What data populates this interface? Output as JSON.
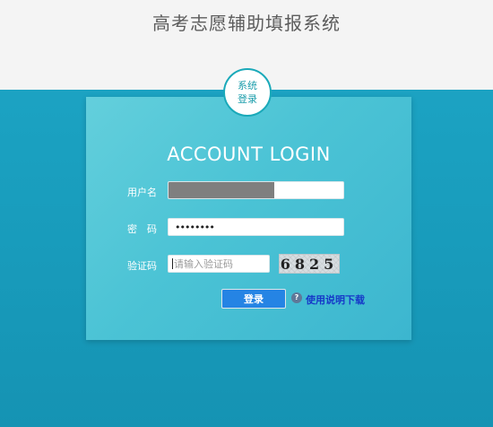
{
  "header": {
    "title": "高考志愿辅助填报系统"
  },
  "badge": {
    "line1": "系统",
    "line2": "登录"
  },
  "login": {
    "heading": "ACCOUNT LOGIN",
    "username_label": "用户名",
    "password_label": "密　码",
    "captcha_label": "验证码",
    "password_value": "••••••••",
    "captcha_placeholder": "请输入验证码",
    "captcha_code": "6825",
    "submit_label": "登录",
    "manual_link": "使用说明下载"
  },
  "icons": {
    "help": "?"
  },
  "colors": {
    "accent": "#2584e4",
    "link": "#1638c8",
    "panel": "#4bc3d5",
    "header_bg": "#f4f4f4"
  }
}
